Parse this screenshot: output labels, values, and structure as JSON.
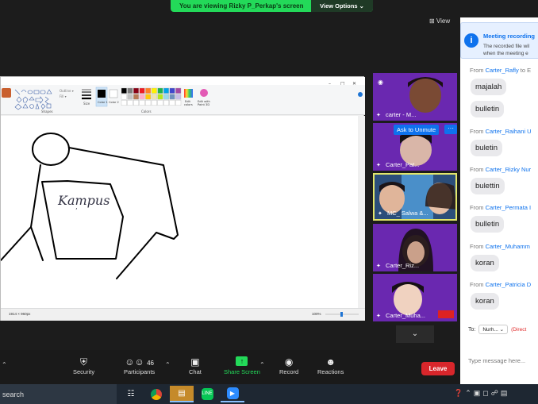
{
  "banner": {
    "viewing_text": "You are viewing Rizky P_Perkap's screen",
    "view_options": "View Options ⌄"
  },
  "view_button": "⊞ View",
  "paint": {
    "ribbon_labels": [
      "Shapes",
      "Size",
      "Color 1",
      "Color 2",
      "Colors",
      "Edit colors",
      "Edit with Paint 3D"
    ],
    "canvas_text": "Kampus",
    "status_dimensions": "1914 × 960px",
    "zoom": "100%"
  },
  "tiles": [
    {
      "name": "carter - M...",
      "color": "#6d27b5"
    },
    {
      "name": "Carter_Pat...",
      "color": "#6d27b5"
    },
    {
      "name": "MC_ Salwa &...",
      "color": "#3a6ea5"
    },
    {
      "name": "Carter_Riz...",
      "color": "#6d27b5"
    },
    {
      "name": "Carter_Muha...",
      "color": "#6d27b5"
    }
  ],
  "ask_to_unmute": "Ask to Unmute",
  "chat": {
    "notice_title": "Meeting recording",
    "notice_body_line1": "The recorded file wil",
    "notice_body_line2": "when the meeting e",
    "messages": [
      {
        "from_label": "From",
        "sender": "Carter_Rafly",
        "suffix": " to E",
        "text": "majalah"
      },
      {
        "from_label": "",
        "sender": "",
        "suffix": "",
        "text": "bulletin"
      },
      {
        "from_label": "From",
        "sender": "Carter_Raihani U",
        "suffix": "",
        "text": "buletin"
      },
      {
        "from_label": "From",
        "sender": "Carter_Rizky Nur",
        "suffix": "",
        "text": "bulettin"
      },
      {
        "from_label": "From",
        "sender": "Carter_Permata I",
        "suffix": "",
        "text": "bulletin"
      },
      {
        "from_label": "From",
        "sender": "Carter_Muhamm",
        "suffix": "",
        "text": "koran"
      },
      {
        "from_label": "From",
        "sender": "Carter_Patricia D",
        "suffix": "",
        "text": "koran"
      }
    ],
    "to_label": "To:",
    "to_value": "Nurh... ⌄",
    "to_direct": "(Direct",
    "input_placeholder": "Type message here..."
  },
  "toolbar": {
    "security": "Security",
    "participants": "Participants",
    "participants_count": "46",
    "chat": "Chat",
    "share_screen": "Share Screen",
    "record": "Record",
    "reactions": "Reactions",
    "leave": "Leave"
  },
  "taskbar": {
    "search": "search"
  },
  "colors": {
    "zoom_green": "#23d959",
    "zoom_blue": "#0e72ed",
    "leave_red": "#d8262b",
    "tile_purple": "#6d27b5"
  }
}
